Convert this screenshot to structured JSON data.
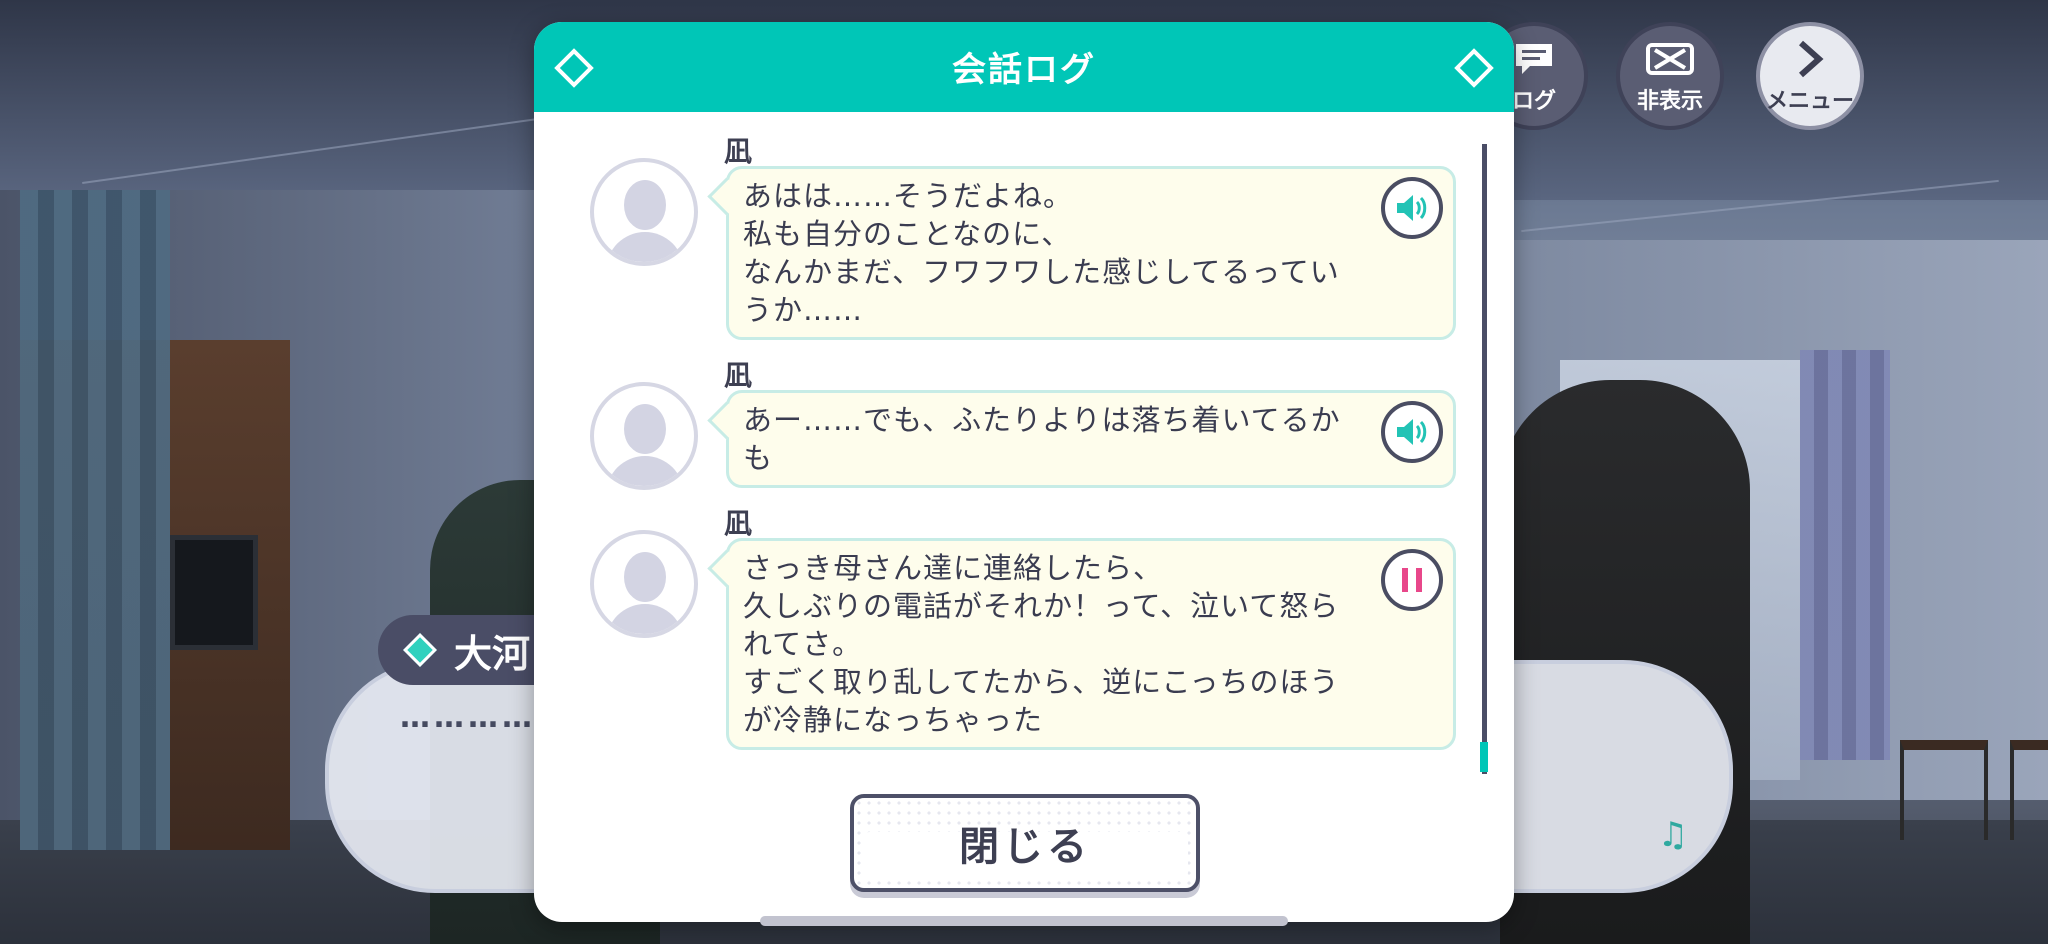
{
  "modal": {
    "title": "会話ログ",
    "close_label": "閉じる"
  },
  "controls": {
    "log_label": "ログ",
    "hide_label": "非表示",
    "menu_label": "メニュー"
  },
  "dialog": {
    "speaker": "大河",
    "text": "…………"
  },
  "log_entries": [
    {
      "speaker": "凪",
      "text": "あはは……そうだよね。\n私も自分のことなのに、\nなんかまだ、フワフワした感じしてるってい\nうか……",
      "voice_state": "play"
    },
    {
      "speaker": "凪",
      "text": "あー……でも、ふたりよりは落ち着いてるか\nも",
      "voice_state": "play"
    },
    {
      "speaker": "凪",
      "text": "さっき母さん達に連絡したら、\n久しぶりの電話がそれか！って、泣いて怒ら\nれてさ。\nすごく取り乱してたから、逆にこっちのほう\nが冷静になっちゃった",
      "voice_state": "pause"
    }
  ],
  "colors": {
    "accent": "#00c6b7",
    "pause": "#e8478a",
    "text": "#3a3c50"
  },
  "icons": [
    "diamond-icon",
    "speaker-icon",
    "pause-icon",
    "chat-icon",
    "hide-icon",
    "menu-chevron-icon",
    "music-note-icon"
  ]
}
